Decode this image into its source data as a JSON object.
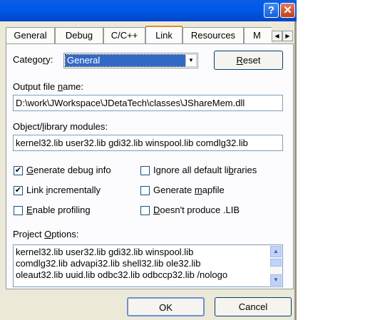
{
  "titlebar": {
    "help_glyph": "?",
    "close_glyph": "✕"
  },
  "tabs": [
    {
      "label": "General",
      "active": false
    },
    {
      "label": "Debug",
      "active": false
    },
    {
      "label": "C/C++",
      "active": false
    },
    {
      "label": "Link",
      "active": true
    },
    {
      "label": "Resources",
      "active": false
    },
    {
      "label": "M",
      "active": false
    }
  ],
  "tab_scroll": {
    "left": "◀",
    "right": "▶"
  },
  "category": {
    "label_pre": "Catego",
    "label_u": "r",
    "label_post": "y:",
    "value": "General"
  },
  "reset_button": {
    "pre": "",
    "u": "R",
    "post": "eset"
  },
  "output_file": {
    "label_pre": "Output file ",
    "label_u": "n",
    "label_post": "ame:",
    "value": "D:\\work\\JWorkspace\\JDetaTech\\classes\\JShareMem.dll"
  },
  "object_modules": {
    "label_pre": "Object/",
    "label_u": "l",
    "label_post": "ibrary modules:",
    "value": "kernel32.lib user32.lib gdi32.lib winspool.lib comdlg32.lib"
  },
  "checkboxes": {
    "generate_debug": {
      "checked": true,
      "pre": "",
      "u": "G",
      "post": "enerate debug info"
    },
    "ignore_defaults": {
      "checked": false,
      "pre": "Ignore all default li",
      "u": "b",
      "post": "raries"
    },
    "link_incrementally": {
      "checked": true,
      "pre": "Link ",
      "u": "i",
      "post": "ncrementally"
    },
    "generate_mapfile": {
      "checked": false,
      "pre": "Generate ",
      "u": "m",
      "post": "apfile"
    },
    "enable_profiling": {
      "checked": false,
      "pre": "",
      "u": "E",
      "post": "nable profiling"
    },
    "no_lib": {
      "checked": false,
      "pre": "",
      "u": "D",
      "post": "oesn't produce .LIB"
    }
  },
  "check_glyph": "✔",
  "project_options": {
    "label_pre": "Project ",
    "label_u": "O",
    "label_post": "ptions:",
    "lines": [
      "kernel32.lib user32.lib gdi32.lib winspool.lib",
      "comdlg32.lib advapi32.lib shell32.lib ole32.lib",
      "oleaut32.lib uuid.lib odbc32.lib odbccp32.lib /nologo"
    ],
    "scroll_up": "▲",
    "scroll_down": "▼"
  },
  "ok_button": "OK",
  "cancel_button": "Cancel",
  "combo_arrow": "▼"
}
